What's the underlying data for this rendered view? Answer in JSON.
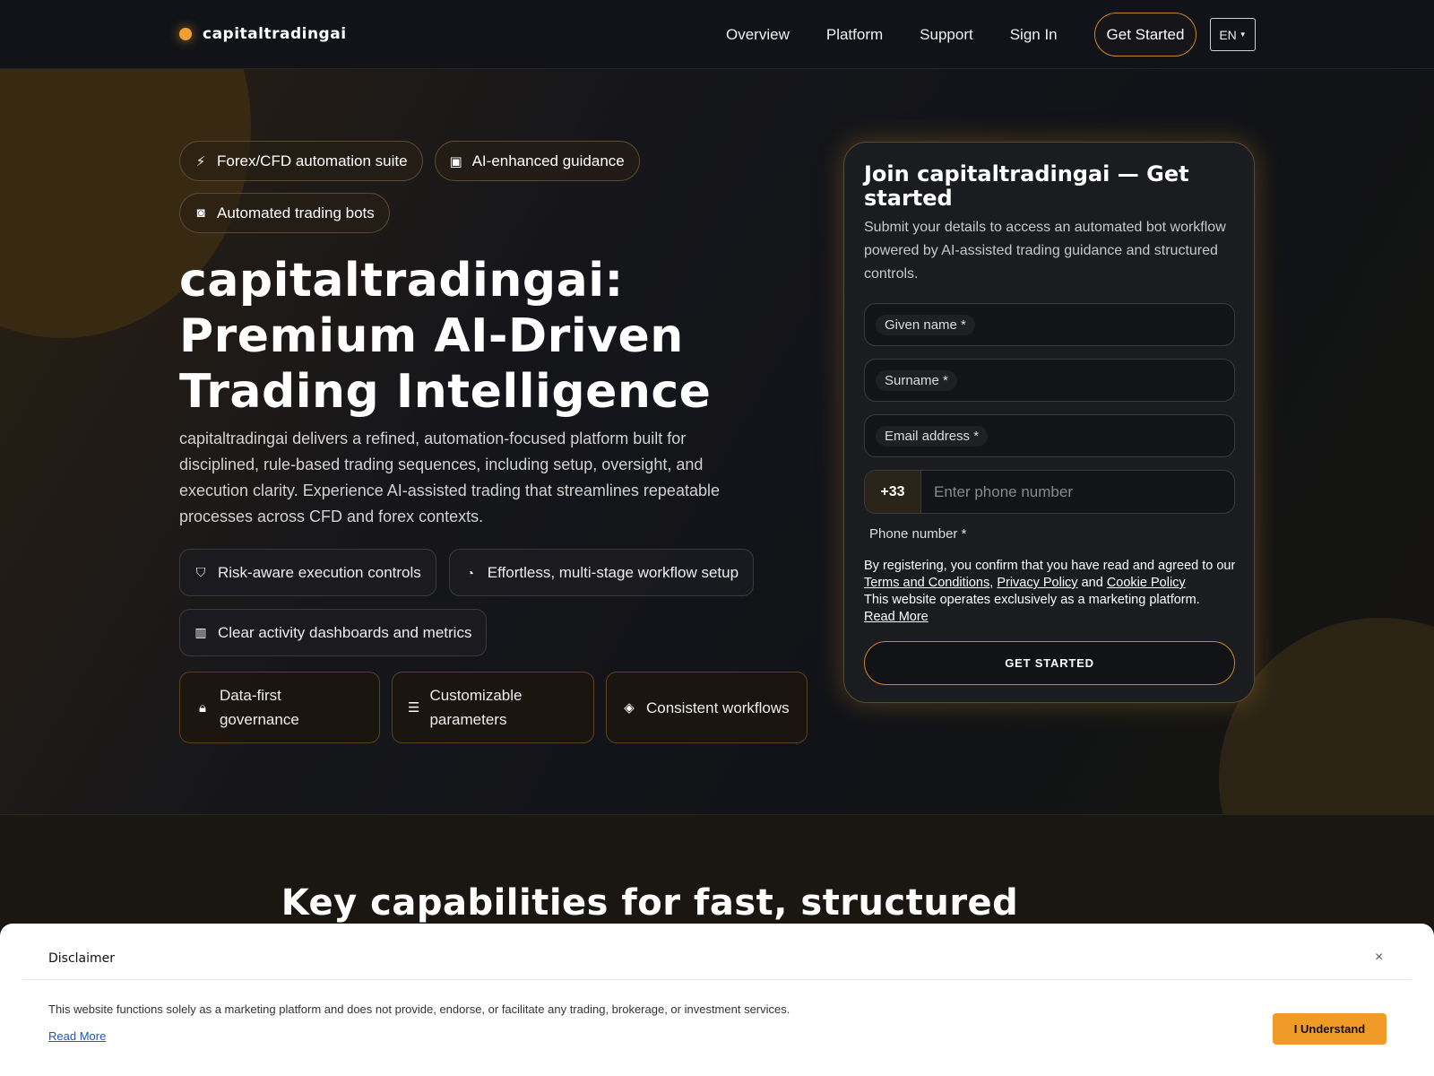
{
  "nav": {
    "brand": "capitaltradingai",
    "links": [
      "Overview",
      "Platform",
      "Support",
      "Sign In"
    ],
    "cta": "Get Started",
    "lang": "EN"
  },
  "hero": {
    "chips": [
      {
        "icon": "lightning-icon",
        "label": "Forex/CFD automation suite"
      },
      {
        "icon": "chip-icon",
        "label": "AI-enhanced guidance"
      },
      {
        "icon": "robot-icon",
        "label": "Automated trading bots"
      }
    ],
    "title": "capitaltradingai: Premium AI-Driven Trading Intelligence",
    "description": "capitaltradingai delivers a refined, automation-focused platform built for disciplined, rule-based trading sequences, including setup, oversight, and execution clarity. Experience AI-assisted trading that streamlines repeatable processes across CFD and forex contexts.",
    "features": [
      {
        "icon": "shield-icon",
        "label": "Risk-aware execution controls"
      },
      {
        "icon": "gauge-icon",
        "label": "Effortless, multi-stage workflow setup"
      },
      {
        "icon": "chart-bar-icon",
        "label": "Clear activity dashboards and metrics"
      }
    ],
    "tiles": [
      {
        "icon": "lock-icon",
        "label": "Data-first governance"
      },
      {
        "icon": "sliders-icon",
        "label": "Customizable parameters"
      },
      {
        "icon": "layers-icon",
        "label": "Consistent workflows"
      }
    ]
  },
  "form": {
    "title": "Join capitaltradingai — Get started",
    "subtitle": "Submit your details to access an automated bot workflow powered by AI-assisted trading guidance and structured controls.",
    "given_name": "Given name *",
    "surname": "Surname *",
    "email": "Email address *",
    "phone_code": "+33",
    "phone_placeholder": "Enter phone number",
    "phone_label": "Phone number *",
    "legal_prefix": "By registering, you confirm that you have read and agreed to our",
    "terms": "Terms and Conditions",
    "privacy": "Privacy Policy",
    "and": "and",
    "cookie": "Cookie Policy",
    "legal_suffix": "This website operates exclusively as a marketing platform.",
    "read_more": "Read More",
    "submit": "GET STARTED"
  },
  "section2": {
    "title": "Key capabilities for fast, structured"
  },
  "disclaimer": {
    "title": "Disclaimer",
    "close": "×",
    "text": "This website functions solely as a marketing platform and does not provide, endorse, or facilitate any trading, brokerage, or investment services.",
    "read_more": "Read More",
    "button": "I Understand"
  },
  "colors": {
    "accent": "#f0a030",
    "background": "#0f1115",
    "disclaimer_button": "#f09a28"
  }
}
